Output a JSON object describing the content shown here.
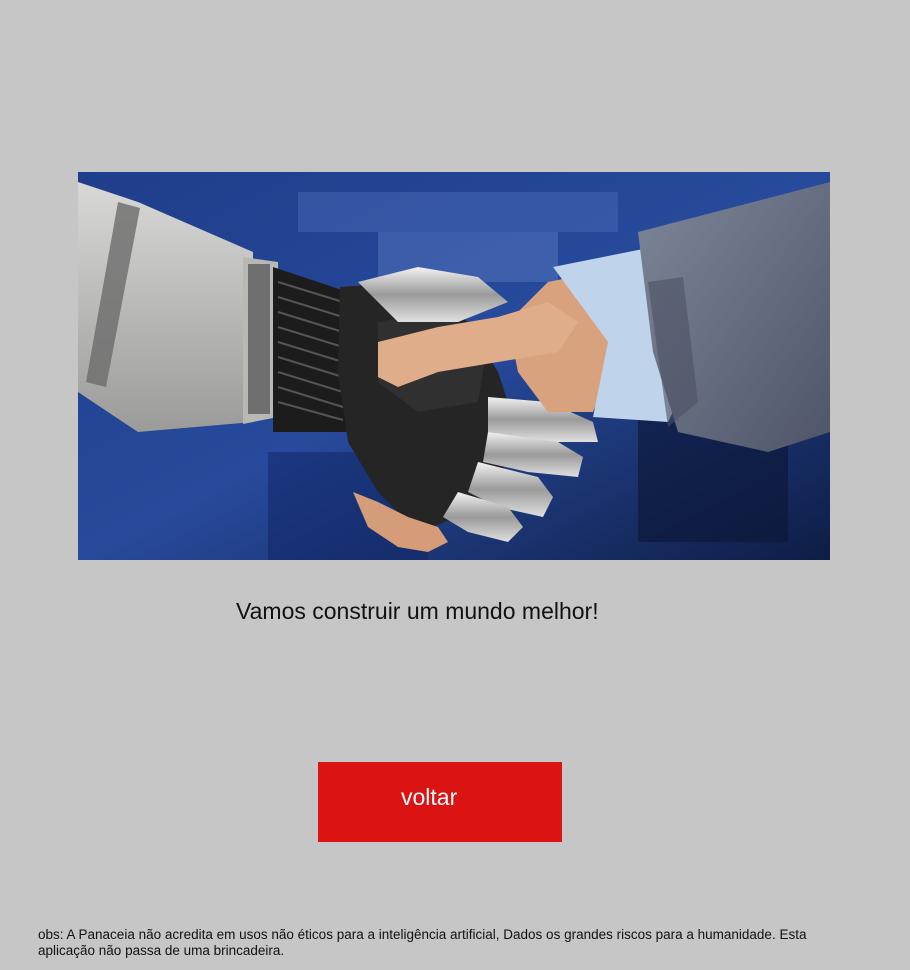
{
  "hero": {
    "image_description": "robot hand shaking human hand"
  },
  "main": {
    "tagline": "Vamos construir um mundo melhor!"
  },
  "actions": {
    "back_label": "voltar",
    "back_color": "#dc1313"
  },
  "footer": {
    "disclaimer": "obs: A Panaceia não acredita em usos não éticos para a inteligência artificial, Dados os grandes riscos para a humanidade. Esta aplicação não passa de uma brincadeira."
  },
  "colors": {
    "background": "#c6c6c6",
    "text": "#111111",
    "button_text": "#ffffff"
  }
}
